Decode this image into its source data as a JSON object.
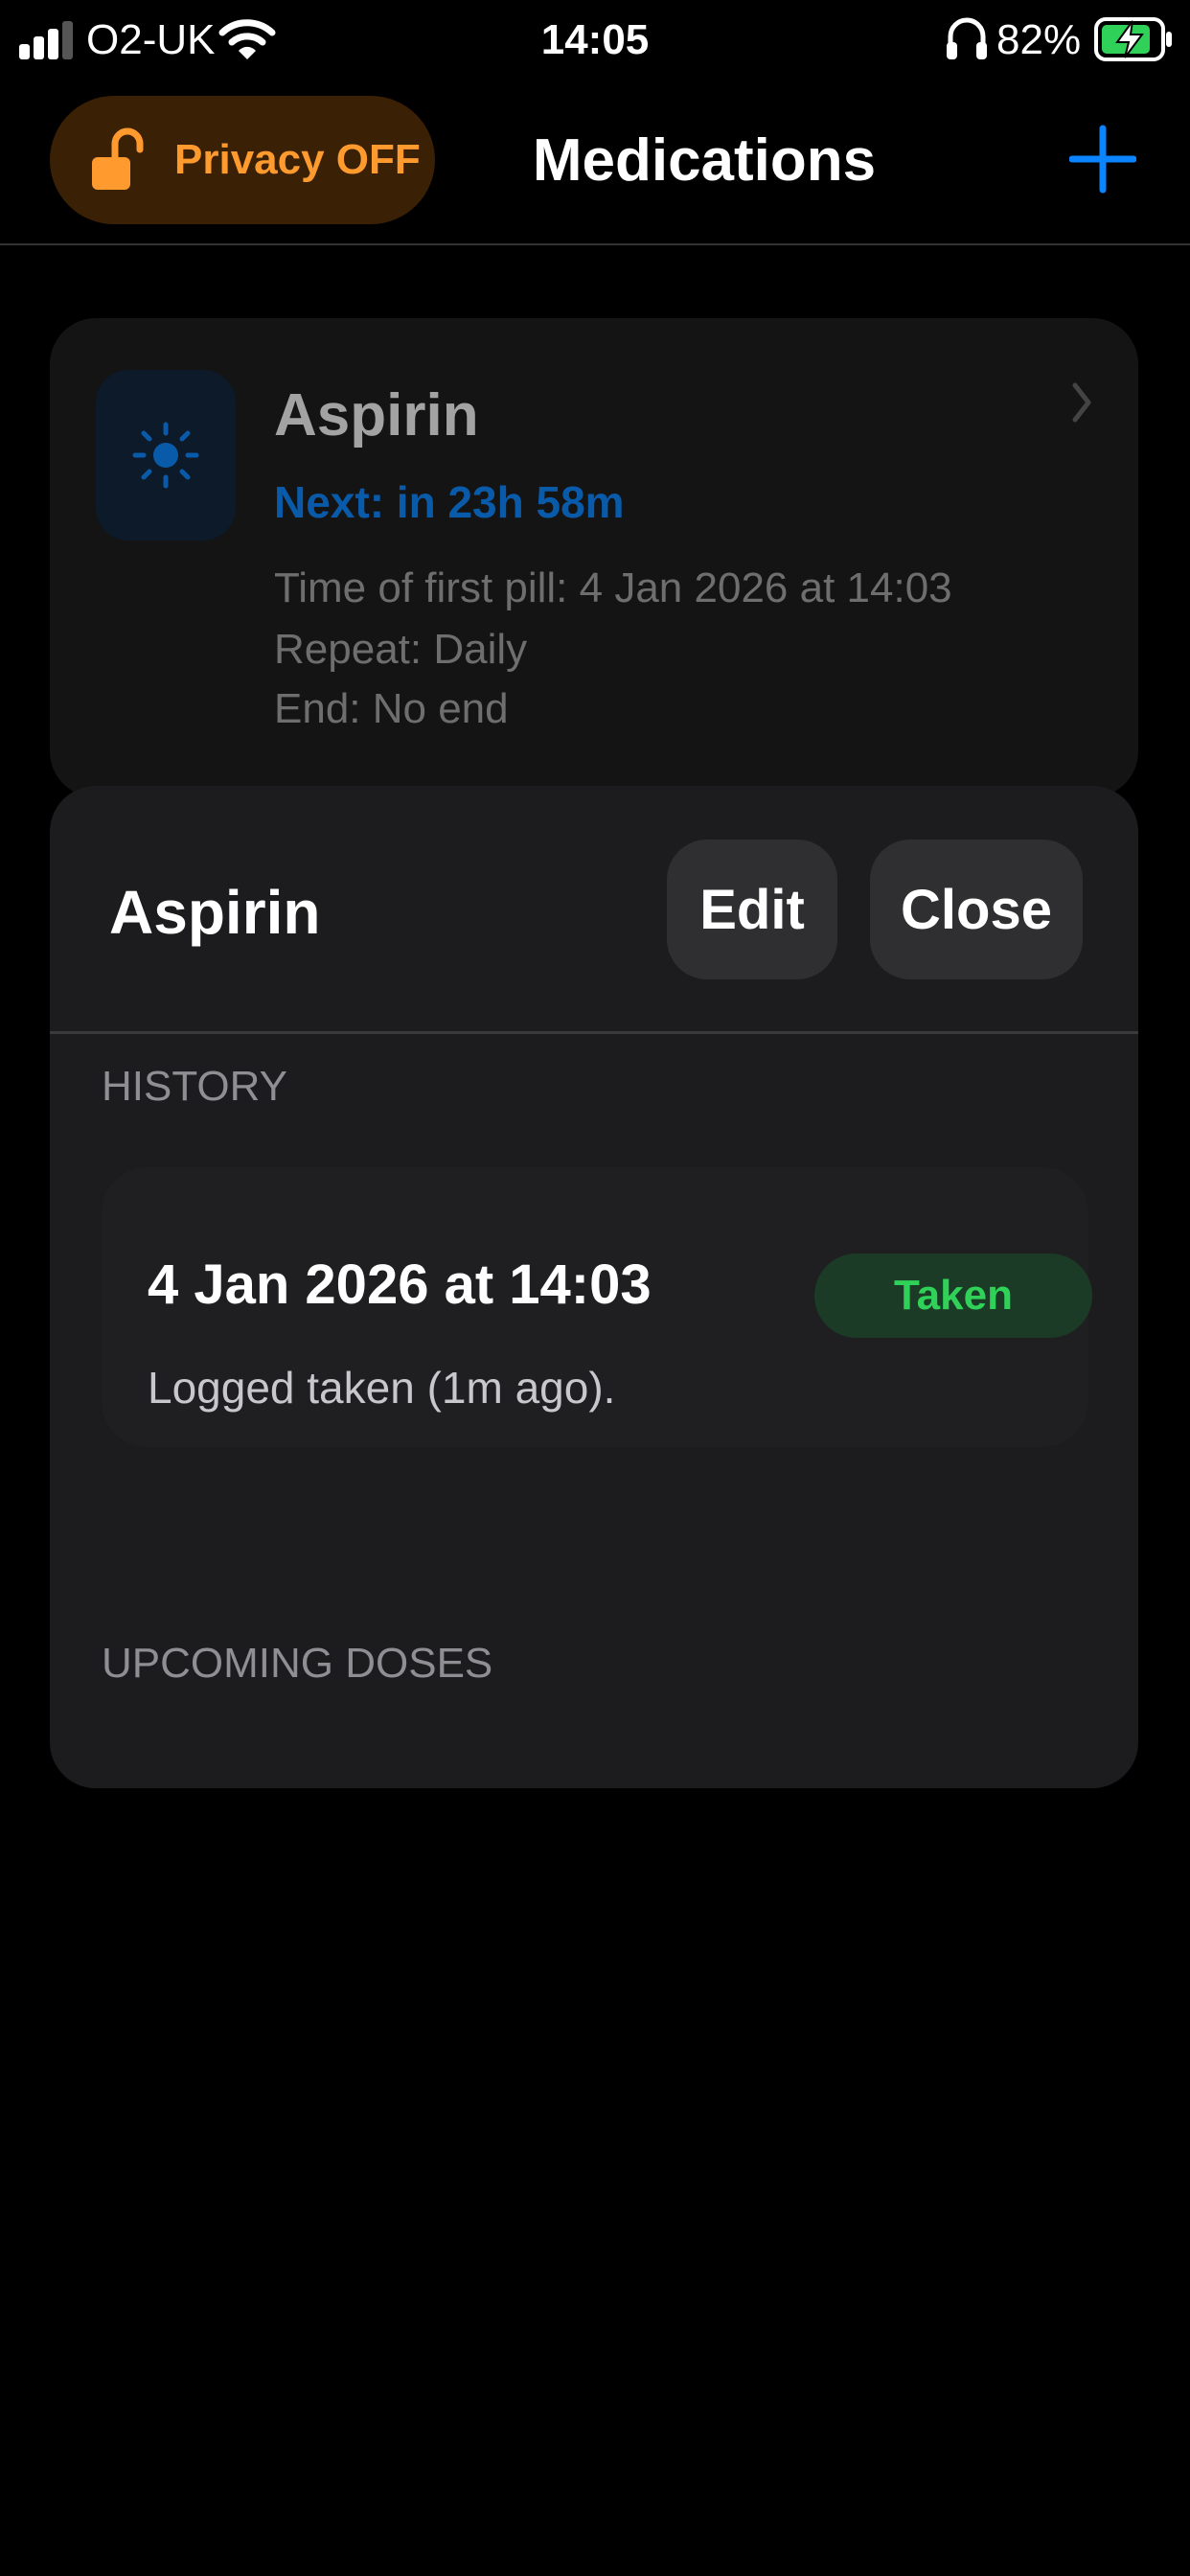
{
  "status_bar": {
    "carrier": "O2-UK",
    "time": "14:05",
    "battery_percent": "82%",
    "signal_bars_active": 3,
    "signal_bars_total": 4,
    "icons": [
      "signal-icon",
      "wifi-icon",
      "headphones-icon",
      "battery-charging-icon"
    ]
  },
  "nav": {
    "privacy_label": "Privacy OFF",
    "privacy_icon": "unlock-icon",
    "title": "Medications",
    "add_icon": "plus-icon"
  },
  "medication": {
    "name": "Aspirin",
    "icon": "sun-icon",
    "next": "Next: in 23h 58m",
    "first_pill": "Time of first pill: 4 Jan 2026 at 14:03",
    "repeat": "Repeat: Daily",
    "end": "End: No end"
  },
  "sheet": {
    "title": "Aspirin",
    "edit_label": "Edit",
    "close_label": "Close",
    "history_header": "HISTORY",
    "history": [
      {
        "date": "4 Jan 2026 at 14:03",
        "status": "Taken",
        "note": "Logged taken (1m ago)."
      }
    ],
    "upcoming_header": "UPCOMING DOSES"
  },
  "colors": {
    "accent_blue": "#0a84ff",
    "privacy_orange": "#ff9a2e",
    "taken_green": "#30d158"
  }
}
